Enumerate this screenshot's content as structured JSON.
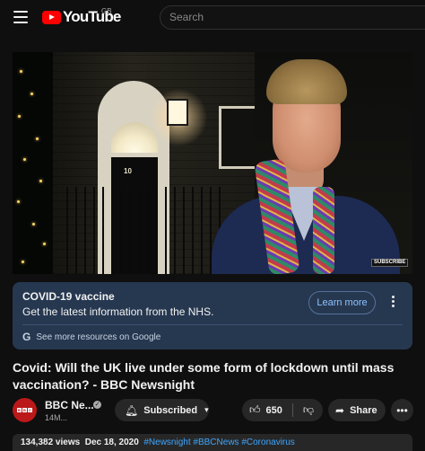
{
  "header": {
    "logo_text": "YouTube",
    "region": "GB",
    "search_placeholder": "Search"
  },
  "video": {
    "overlay_subscribe": "SUBSCRIBE",
    "door_number": "10"
  },
  "info_panel": {
    "title": "COVID-19 vaccine",
    "subtitle": "Get the latest information from the NHS.",
    "learn_more": "Learn more",
    "google_link": "See more resources on Google"
  },
  "title": "Covid: Will the UK live under some form of lockdown until mass vaccination? - BBC Newsnight",
  "channel": {
    "name": "BBC Ne...",
    "subscribers": "14M...",
    "subscribed_label": "Subscribed",
    "avatar_letters": [
      "B",
      "B",
      "C"
    ]
  },
  "actions": {
    "like_count": "650",
    "share_label": "Share"
  },
  "description": {
    "views": "134,382 views",
    "date": "Dec 18, 2020",
    "tags": [
      "#Newsnight",
      "#BBCNews",
      "#Coronavirus"
    ]
  },
  "colors": {
    "brand_red": "#ff0000",
    "info_panel_bg": "#263850",
    "link_blue": "#3ea6ff",
    "bbc_red": "#bb1919"
  },
  "icons": [
    "menu-icon",
    "youtube-logo-icon",
    "kebab-icon",
    "google-icon",
    "verified-icon",
    "bell-icon",
    "chevron-down-icon",
    "thumbs-up-icon",
    "thumbs-down-icon",
    "share-icon",
    "more-icon"
  ]
}
